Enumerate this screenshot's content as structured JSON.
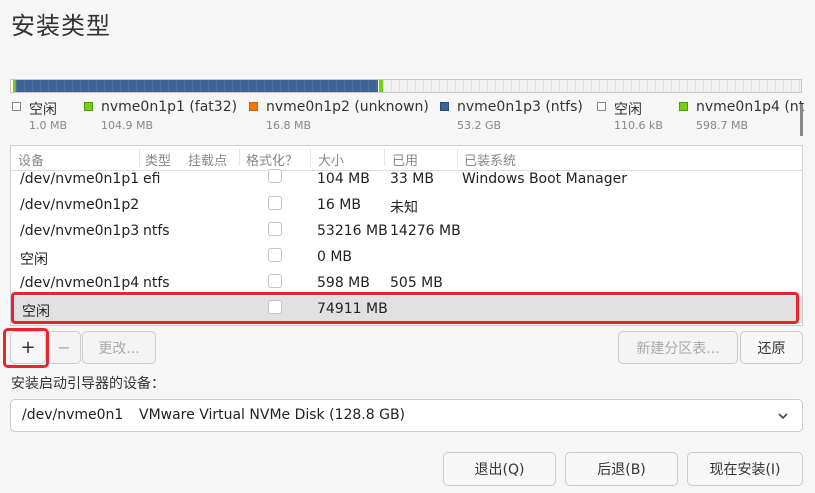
{
  "page": {
    "title": "安装类型"
  },
  "legend": [
    {
      "name": "空闲",
      "size": "1.0 MB",
      "swatch": "free"
    },
    {
      "name": "nvme0n1p1 (fat32)",
      "size": "104.9 MB",
      "swatch": "green"
    },
    {
      "name": "nvme0n1p2 (unknown)",
      "size": "16.8 MB",
      "swatch": "orange"
    },
    {
      "name": "nvme0n1p3 (ntfs)",
      "size": "53.2 GB",
      "swatch": "blue"
    },
    {
      "name": "空闲",
      "size": "110.6 kB",
      "swatch": "free"
    },
    {
      "name": "nvme0n1p4 (nt",
      "size": "598.7 MB",
      "swatch": "green"
    }
  ],
  "colors": {
    "fat32": "#73d216",
    "unknown": "#f57900",
    "ntfs": "#3e6396",
    "highlight": "#e8242c"
  },
  "table": {
    "headers": [
      "设备",
      "类型",
      "挂载点",
      "格式化？",
      "大小",
      "已用",
      "已装系统"
    ],
    "rows": [
      {
        "device": "/dev/nvme0n1p1",
        "type": "efi",
        "mount": "",
        "size": "104 MB",
        "used": "33 MB",
        "system": "Windows Boot Manager"
      },
      {
        "device": "/dev/nvme0n1p2",
        "type": "",
        "mount": "",
        "size": "16 MB",
        "used": "未知",
        "system": ""
      },
      {
        "device": "/dev/nvme0n1p3",
        "type": "ntfs",
        "mount": "",
        "size": "53216 MB",
        "used": "14276 MB",
        "system": ""
      },
      {
        "device": "空闲",
        "type": "",
        "mount": "",
        "size": "0 MB",
        "used": "",
        "system": ""
      },
      {
        "device": "/dev/nvme0n1p4",
        "type": "ntfs",
        "mount": "",
        "size": "598 MB",
        "used": "505 MB",
        "system": ""
      },
      {
        "device": "空闲",
        "type": "",
        "mount": "",
        "size": "74911 MB",
        "used": "",
        "system": ""
      }
    ]
  },
  "actions": {
    "add": "+",
    "remove": "−",
    "change": "更改...",
    "new_table": "新建分区表...",
    "revert": "还原"
  },
  "bootloader": {
    "label": "安装启动引导器的设备：",
    "device": "/dev/nvme0n1",
    "description": "VMware Virtual NVMe Disk (128.8 GB)"
  },
  "footer": {
    "quit": "退出(Q)",
    "back": "后退(B)",
    "install": "现在安装(I)"
  }
}
